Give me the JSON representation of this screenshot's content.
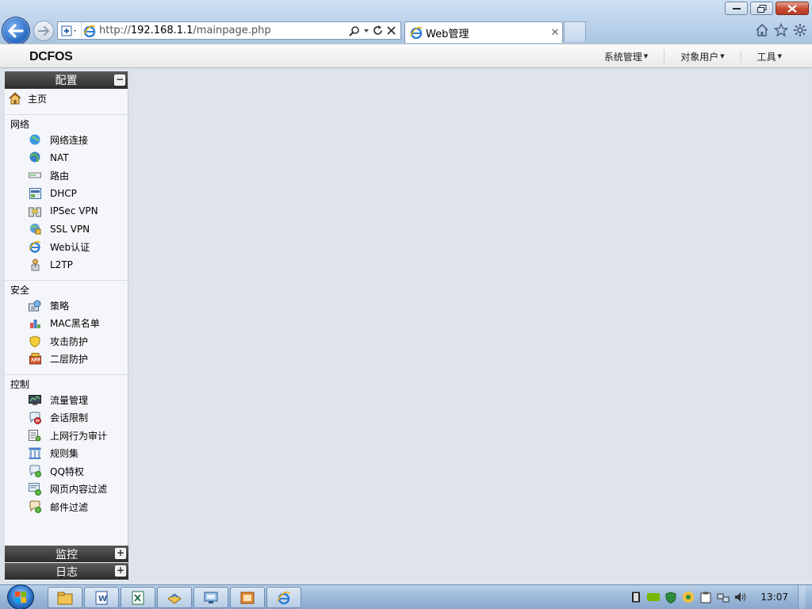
{
  "browser": {
    "address": {
      "prefix": "http://",
      "host": "192.168.1.1",
      "path": "/mainpage.php"
    },
    "tab": {
      "title": "Web管理",
      "close": "✕"
    },
    "icons": [
      "back-arrow-icon",
      "forward-arrow-icon",
      "compat-icon",
      "ie-icon",
      "search-icon",
      "refresh-icon",
      "stop-icon",
      "home-icon",
      "favorites-star-icon",
      "gear-icon"
    ]
  },
  "header": {
    "logo": "DCFOS",
    "menu": [
      {
        "label": "系统管理"
      },
      {
        "label": "对象用户"
      },
      {
        "label": "工具"
      }
    ]
  },
  "sidebar": {
    "title": "配置",
    "collapse_symbol": "−",
    "home": "主页",
    "groups": [
      {
        "name": "网络",
        "items": [
          "网络连接",
          "NAT",
          "路由",
          "DHCP",
          "IPSec VPN",
          "SSL VPN",
          "Web认证",
          "L2TP"
        ]
      },
      {
        "name": "安全",
        "items": [
          "策略",
          "MAC黑名单",
          "攻击防护",
          "二层防护"
        ]
      },
      {
        "name": "控制",
        "items": [
          "流量管理",
          "会话限制",
          "上网行为审计",
          "规则集",
          "QQ特权",
          "网页内容过滤",
          "邮件过滤"
        ]
      }
    ],
    "bottom_panels": [
      {
        "label": "监控",
        "symbol": "+"
      },
      {
        "label": "日志",
        "symbol": "+"
      }
    ]
  },
  "taskbar": {
    "clock": "13:07",
    "buttons": [
      "explorer-icon",
      "word-icon",
      "excel-icon",
      "app-icon",
      "remote-icon",
      "media-icon",
      "ie-icon"
    ]
  }
}
